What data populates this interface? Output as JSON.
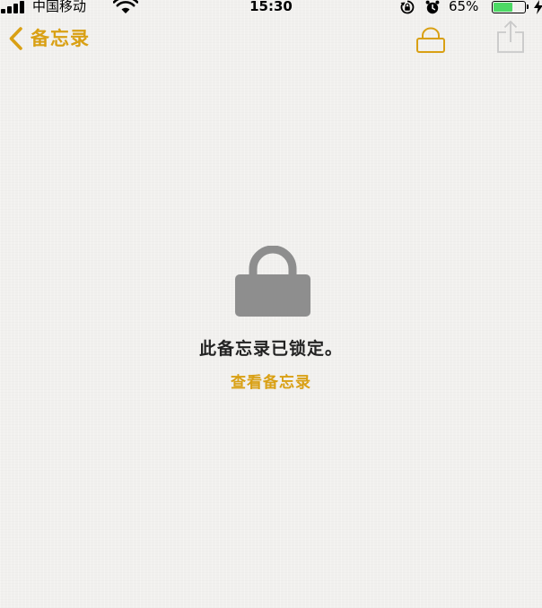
{
  "status_bar": {
    "carrier": "中国移动",
    "time": "15:30",
    "battery_percent": "65%",
    "battery_level": 0.65,
    "icons": [
      "signal-icon",
      "wifi-icon",
      "lock-rotation-icon",
      "alarm-icon",
      "battery-icon",
      "charging-icon"
    ]
  },
  "nav": {
    "back_label": "备忘录",
    "back_icon": "chevron-left-icon",
    "lock_icon": "lock-icon",
    "share_icon": "share-icon"
  },
  "content": {
    "locked_message": "此备忘录已锁定。",
    "view_note_label": "查看备忘录",
    "lock_icon": "lock-icon"
  },
  "colors": {
    "accent": "#d9a014",
    "lock_gray": "#8e8e8e",
    "battery_green": "#4cd964",
    "background": "#f1f0ee"
  }
}
